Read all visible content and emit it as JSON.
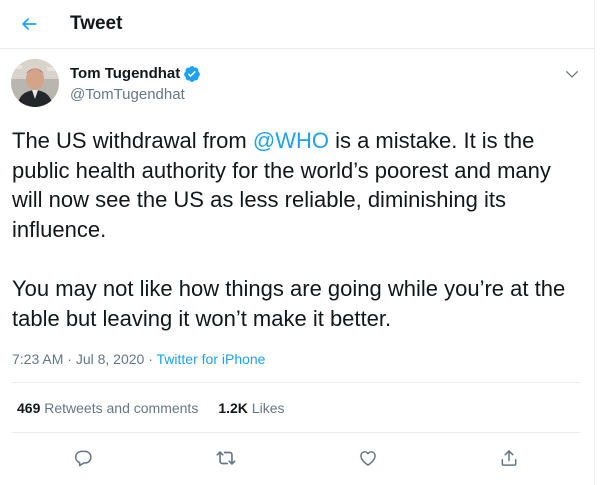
{
  "header": {
    "title": "Tweet",
    "back_icon": "arrow-left-icon"
  },
  "colors": {
    "accent": "#1da1f2",
    "text": "#14171a",
    "secondary_text": "#657786",
    "divider": "#e6ecf0"
  },
  "author": {
    "name": "Tom Tugendhat",
    "handle": "@TomTugendhat",
    "verified": true
  },
  "tweet": {
    "text_part1": "The US withdrawal from ",
    "mention": "@WHO",
    "text_part2": " is a mistake. It is the public health authority for the world’s poorest and many will now see the US as less reliable, diminishing its influence.",
    "paragraph2": "You may not like how things are going while you’re at the table but leaving it won’t make it better.",
    "time": "7:23 AM",
    "separator": " · ",
    "date": "Jul 8, 2020",
    "source": "Twitter for iPhone"
  },
  "stats": {
    "retweets_count": "469",
    "retweets_label": "Retweets and comments",
    "likes_count": "1.2K",
    "likes_label": "Likes"
  },
  "actions": [
    "reply-icon",
    "retweet-icon",
    "like-icon",
    "share-icon"
  ]
}
